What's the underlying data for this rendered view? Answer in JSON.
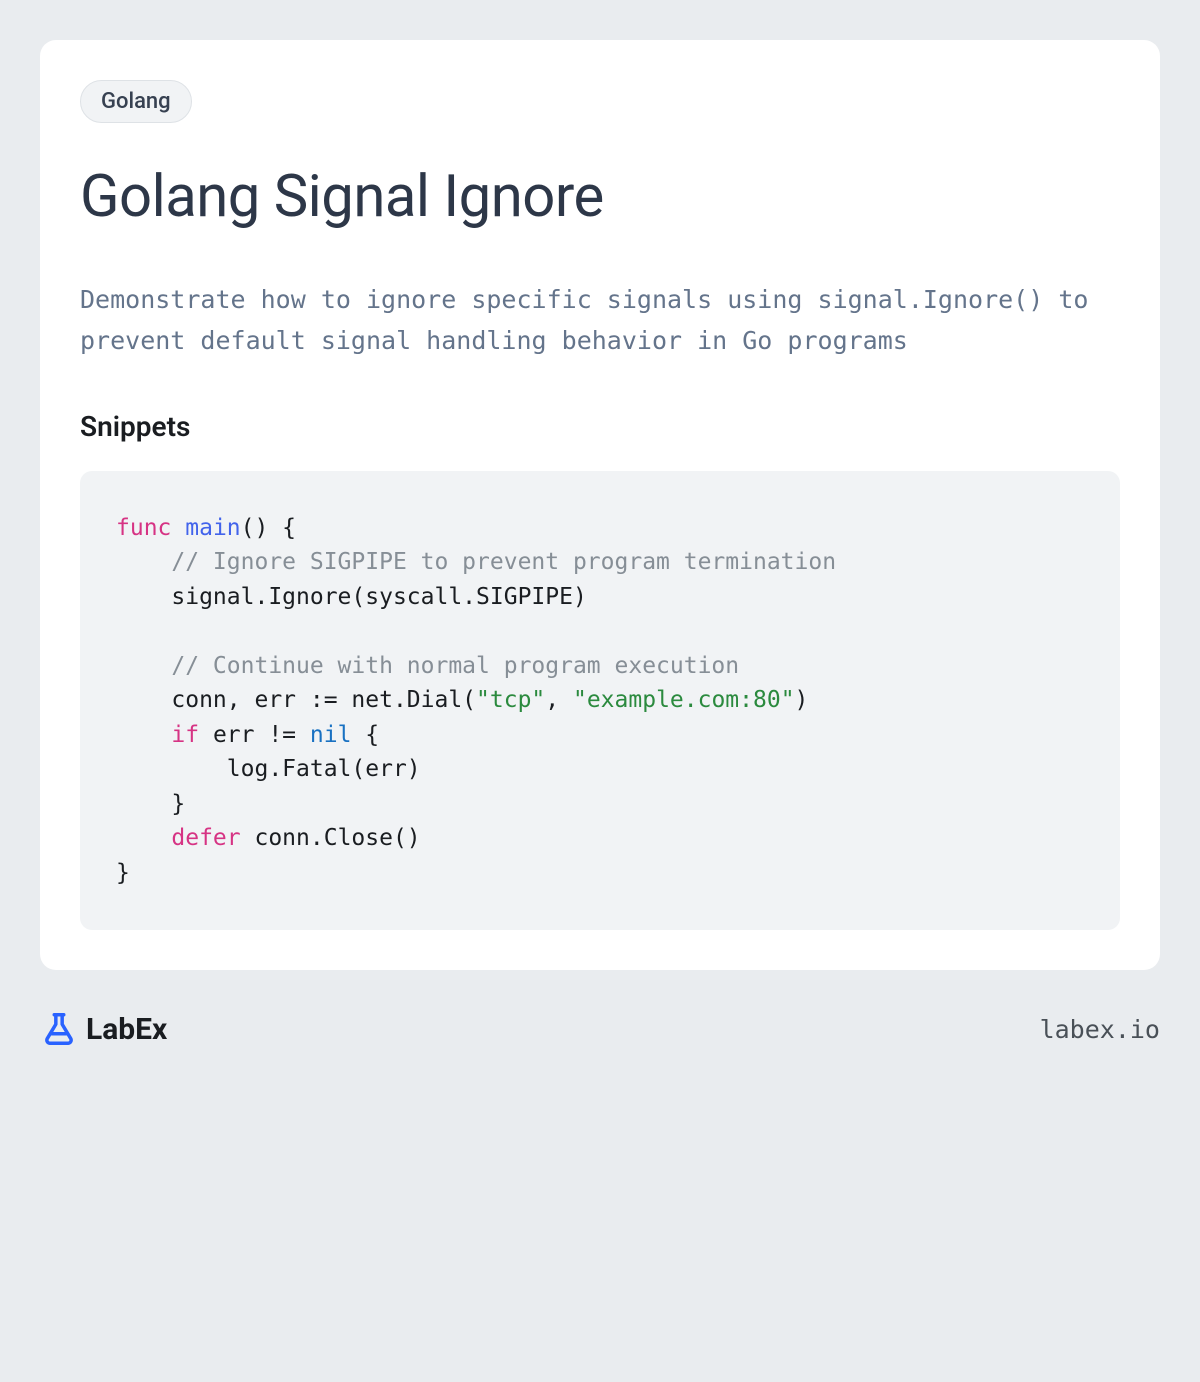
{
  "badge": "Golang",
  "title": "Golang Signal Ignore",
  "description": "Demonstrate how to ignore specific signals using signal.Ignore() to prevent default signal handling behavior in Go programs",
  "snippets_heading": "Snippets",
  "code": {
    "tokens": [
      {
        "t": "func ",
        "c": "kw"
      },
      {
        "t": "main",
        "c": "fn"
      },
      {
        "t": "() {\n    ",
        "c": ""
      },
      {
        "t": "// Ignore SIGPIPE to prevent program termination",
        "c": "cm"
      },
      {
        "t": "\n    signal.Ignore(syscall.SIGPIPE)\n\n    ",
        "c": ""
      },
      {
        "t": "// Continue with normal program execution",
        "c": "cm"
      },
      {
        "t": "\n    conn, err := net.Dial(",
        "c": ""
      },
      {
        "t": "\"tcp\"",
        "c": "str"
      },
      {
        "t": ", ",
        "c": ""
      },
      {
        "t": "\"example.com:80\"",
        "c": "str"
      },
      {
        "t": ")\n    ",
        "c": ""
      },
      {
        "t": "if",
        "c": "kw"
      },
      {
        "t": " err != ",
        "c": ""
      },
      {
        "t": "nil",
        "c": "lit"
      },
      {
        "t": " {\n        log.Fatal(err)\n    }\n    ",
        "c": ""
      },
      {
        "t": "defer",
        "c": "kw"
      },
      {
        "t": " conn.Close()\n}",
        "c": ""
      }
    ]
  },
  "footer": {
    "brand_text": "LabEx",
    "domain": "labex.io"
  }
}
